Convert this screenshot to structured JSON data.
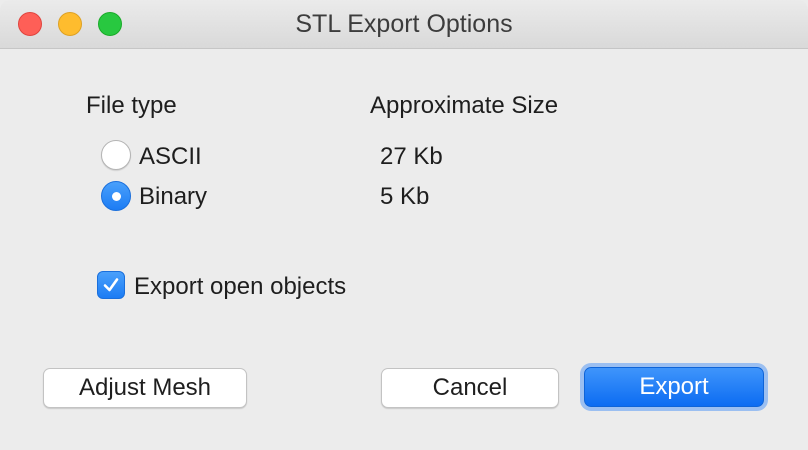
{
  "window": {
    "title": "STL Export Options"
  },
  "file_type": {
    "heading": "File type",
    "options": [
      {
        "label": "ASCII",
        "selected": false,
        "size": "27 Kb"
      },
      {
        "label": "Binary",
        "selected": true,
        "size": "5 Kb"
      }
    ]
  },
  "size": {
    "heading": "Approximate Size"
  },
  "export_open_objects": {
    "label": "Export open objects",
    "checked": true
  },
  "buttons": {
    "adjust_mesh": "Adjust Mesh",
    "cancel": "Cancel",
    "export": "Export"
  },
  "colors": {
    "accent": "#1c7cf4",
    "close": "#fe5f57",
    "minimize": "#febc2e",
    "maximize": "#28c840"
  }
}
